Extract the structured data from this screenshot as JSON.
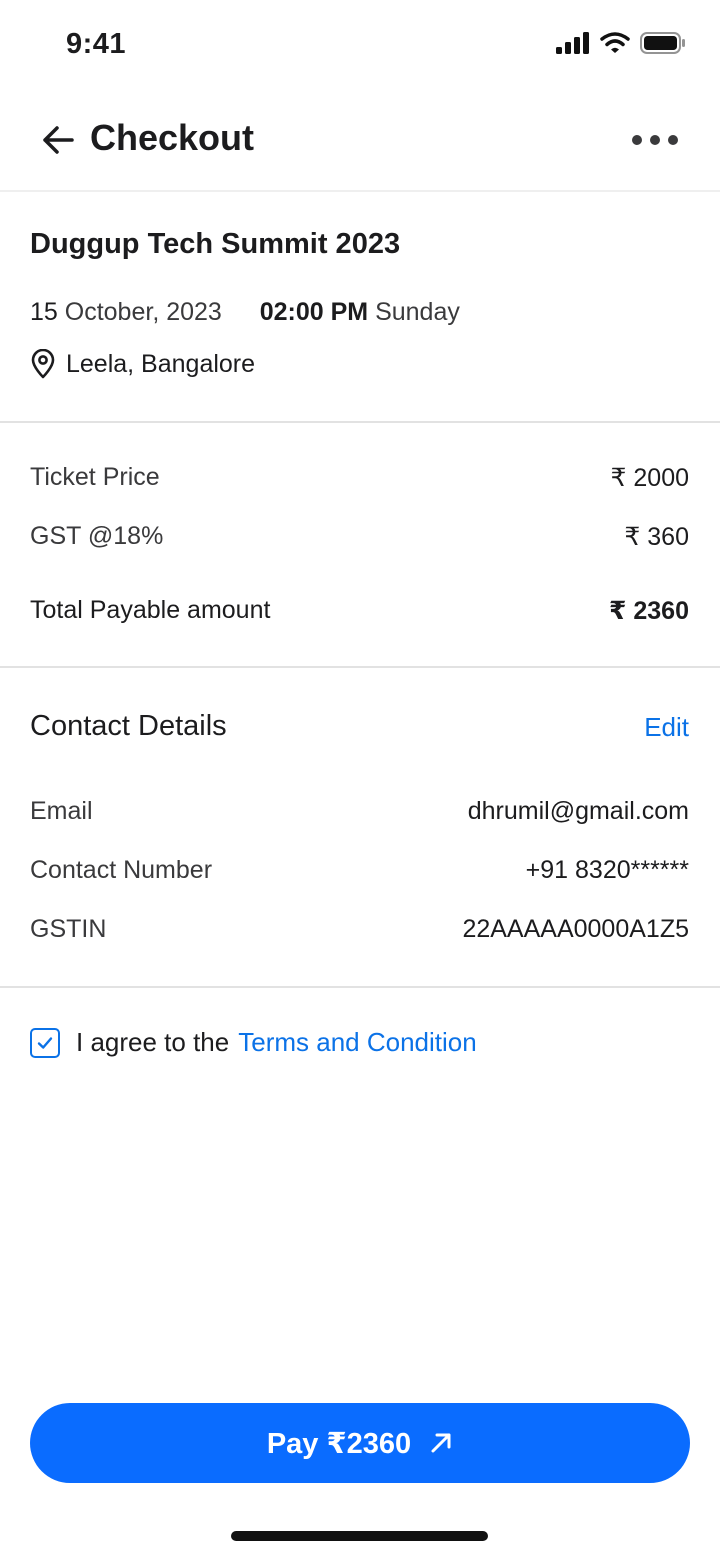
{
  "status_bar": {
    "time": "9:41"
  },
  "header": {
    "title": "Checkout"
  },
  "event": {
    "title": "Duggup Tech Summit 2023",
    "day": "15",
    "month_year": "October, 2023",
    "time": "02:00 PM",
    "weekday": "Sunday",
    "location": "Leela, Bangalore"
  },
  "pricing": {
    "ticket_label": "Ticket Price",
    "ticket_value": "₹ 2000",
    "gst_label": "GST @18%",
    "gst_value": "₹ 360",
    "total_label": "Total Payable amount",
    "total_value": "₹ 2360"
  },
  "contact": {
    "title": "Contact Details",
    "edit_label": "Edit",
    "email_label": "Email",
    "email_value": "dhrumil@gmail.com",
    "phone_label": "Contact Number",
    "phone_value": "+91 8320******",
    "gstin_label": "GSTIN",
    "gstin_value": "22AAAAA0000A1Z5"
  },
  "agreement": {
    "checked": true,
    "prefix": "I agree to the",
    "link": "Terms and Condition"
  },
  "pay_button": {
    "label": "Pay ₹2360"
  },
  "colors": {
    "accent": "#0a6cff",
    "link": "#0b72e7"
  },
  "icons": [
    "back-arrow-icon",
    "more-icon",
    "location-pin-icon",
    "check-icon",
    "arrow-up-right-icon",
    "signal-icon",
    "wifi-icon",
    "battery-icon"
  ]
}
